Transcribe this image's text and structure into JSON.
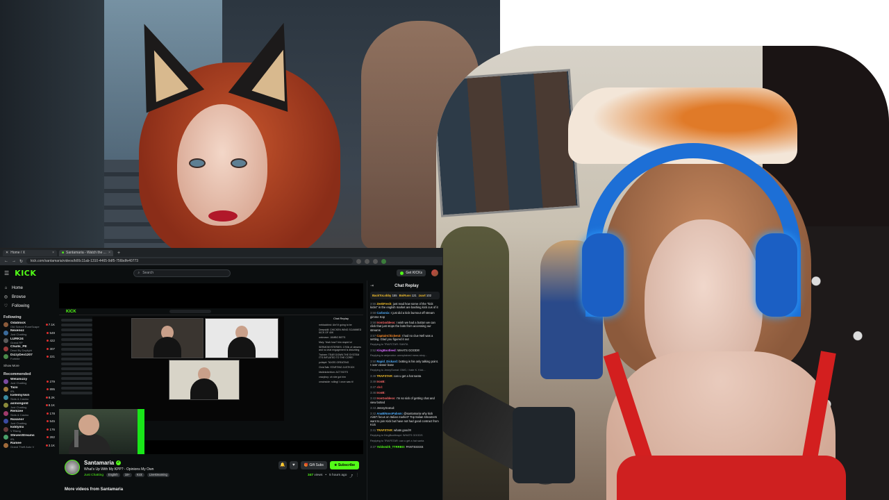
{
  "browser": {
    "tabs": [
      {
        "label": "Home / X",
        "active": false
      },
      {
        "label": "Santamaria - Watch the ...",
        "active": true
      }
    ],
    "url": "kick.com/santamaria/videos/b00c11ab-1310-4465-9df5-756bdfe40773"
  },
  "kick": {
    "logo": "KICK",
    "search_placeholder": "Search",
    "get_kicks_label": "Get KICKs",
    "nav": [
      {
        "icon": "home-icon",
        "glyph": "⌂",
        "label": "Home"
      },
      {
        "icon": "compass-icon",
        "glyph": "◎",
        "label": "Browse"
      },
      {
        "icon": "heart-icon",
        "glyph": "♡",
        "label": "Following"
      }
    ],
    "following_header": "Following",
    "following": [
      {
        "name": "Odablock",
        "sub": "Old School RuneScape",
        "viewers": "7.1K",
        "color": "#8a5a3a"
      },
      {
        "name": "Nexenoz",
        "sub": "Just Chatting",
        "viewers": "549",
        "color": "#3a6a9a"
      },
      {
        "name": "LURK24",
        "sub": "Grand RP",
        "viewers": "422",
        "color": "#5a5a5a"
      },
      {
        "name": "Chulls_PE",
        "sub": "Dead By Daylight",
        "viewers": "307",
        "color": "#9a3a3a"
      },
      {
        "name": "DizzyDev1207",
        "sub": "Fortnite",
        "viewers": "221",
        "color": "#4a8a4a"
      }
    ],
    "show_more": "Show More",
    "recommended_header": "Recommended",
    "recommended": [
      {
        "name": "Welamizzy",
        "sub": "Just Chatting",
        "viewers": "279",
        "color": "#7a4aa0"
      },
      {
        "name": "Tazo",
        "sub": "IRL",
        "viewers": "895",
        "color": "#a07a3a"
      },
      {
        "name": "Icelemyrwin",
        "sub": "Slots & Casino",
        "viewers": "8.2K",
        "color": "#3a8aa0"
      },
      {
        "name": "asmongold",
        "sub": "Just Chatting",
        "viewers": "8.1K",
        "color": "#8a8a3a"
      },
      {
        "name": "Remzee",
        "sub": "Slots & Casino",
        "viewers": "178",
        "color": "#a03a6a"
      },
      {
        "name": "Nuxanor",
        "sub": "Just Chatting",
        "viewers": "545",
        "color": "#3a4aa0"
      },
      {
        "name": "kiddymx",
        "sub": "V Rising",
        "viewers": "176",
        "color": "#6a3a3a"
      },
      {
        "name": "StevenStreams",
        "sub": "IRL",
        "viewers": "282",
        "color": "#4aa06a"
      },
      {
        "name": "Ramee",
        "sub": "Grand Theft Auto V",
        "viewers": "3.1K",
        "color": "#a06a3a"
      }
    ],
    "inner_chat_header": "Chat Replay",
    "inner_chat_lines": [
      "mrblackbird: Ain't it going to be",
      "Deepskill: CHICKEN WING SCAMMED KICK OF 40K",
      "unknown: JUMBO BETS",
      "Mwy: Yeah how? him stupid lol",
      "SERMONYSTERIES: 1700k of viewers and no chat engagement is disturbing",
      "Trainee: TEAR DOWN THE SYSTEM IT'S INFLATED TO THE CORE!",
      "pcbiqet: TAXES GREATING",
      "ChrisTalk: STARTING JUSTKICK",
      "kiwiknickerbon: ACT BOTS",
      "crazyboy: oh she got him",
      "omainside: rolling! I once saw it!"
    ],
    "streamer": {
      "name": "Santamaria",
      "title": "What's Up With My KPP? - Opinions My Own",
      "category": "Just Chatting",
      "tags": [
        "English",
        "18+",
        "Kick",
        "Livestreaming"
      ],
      "gift_label": "Gift Subs",
      "subscribe_label": "Subscribe",
      "views": "347",
      "views_label": "views",
      "age": "5 hours ago",
      "more_videos": "More videos from Santamaria"
    },
    "chat": {
      "title": "Chat Replay",
      "pinned": [
        {
          "name": "BackToLobby",
          "count": "155"
        },
        {
          "name": "BoiRuss",
          "count": "121"
        },
        {
          "name": "zoart",
          "count": "102"
        }
      ],
      "messages": [
        {
          "ts": "3:55",
          "user": "ZeekFresh:",
          "color": "#f6c12d",
          "text": "just read how some of the \"kick kicks\" in the english market are bashing kick cus of it",
          "reply": ""
        },
        {
          "ts": "3:58",
          "user": "Carbonix:",
          "color": "#53b0ff",
          "text": "I just did a kick burnout off stream gimme Kop",
          "reply": ""
        },
        {
          "ts": "3:58",
          "user": "IronGoddess:",
          "color": "#ff6a6a",
          "text": "I wish we had a button we can click that just stops the bots from accessing our streams",
          "reply": ""
        },
        {
          "ts": "3:57",
          "user": "CaptainChicken3:",
          "color": "#ff8c2a",
          "text": "I had no clue Nell was a setting. Glad you figured it out",
          "reply": ""
        },
        {
          "ts": "",
          "user": "",
          "color": "#e2e2e2",
          "text": "",
          "reply": "Replying to TRAFCTAR: SANTA"
        },
        {
          "ts": "3:52",
          "user": "KingBootleed:",
          "color": "#d86aff",
          "text": "WHATS GOOD!!!",
          "reply": ""
        },
        {
          "ts": "",
          "user": "",
          "color": "#e2e2e2",
          "text": "",
          "reply": "Replying to aniproctor: unexplained mess story..."
        },
        {
          "ts": "3:50",
          "user": "Rapid_Dickard:",
          "color": "#53b0ff",
          "text": "botting is his only talking point. I over viewer base",
          "reply": ""
        },
        {
          "ts": "",
          "user": "",
          "color": "#e2e2e2",
          "text": "",
          "reply": "Replying to JennySomal: OMG, i hate K. Kick..."
        },
        {
          "ts": "3:49",
          "user": "TRAFSTAR:",
          "color": "#f6c12d",
          "text": "can u get a hat santa",
          "reply": ""
        },
        {
          "ts": "3:49",
          "user": "IronB:",
          "color": "#ff6a6a",
          "text": "",
          "reply": ""
        },
        {
          "ts": "3:47",
          "user": "shd:",
          "color": "#e05050",
          "text": "",
          "reply": ""
        },
        {
          "ts": "3:46",
          "user": "IronB:",
          "color": "#ff6a6a",
          "text": "",
          "reply": ""
        },
        {
          "ts": "3:43",
          "user": "IronGoddess:",
          "color": "#ff6a6a",
          "text": "I'm so sick of getting chat and view botted",
          "reply": ""
        },
        {
          "ts": "3:43",
          "user": "JennySomal:",
          "color": "#b0b0b0",
          "text": "",
          "reply": ""
        },
        {
          "ts": "3:42",
          "user": "AnaBiNovoPabsm:",
          "color": "#53b0ff",
          "text": "@santamaria why kick Aintr't focus on Italian market? Top Italian streamers want to join Kick but have not had good contract from Kick",
          "reply": ""
        },
        {
          "ts": "3:41",
          "user": "TRAFSTAR:",
          "color": "#f6c12d",
          "text": "whats good!!!",
          "reply": ""
        },
        {
          "ts": "",
          "user": "",
          "color": "#e2e2e2",
          "text": "",
          "reply": "Replying to KingBootfeayd: WHATS GOODS"
        },
        {
          "ts": "",
          "user": "",
          "color": "#e2e2e2",
          "text": "",
          "reply": "Replying to TRAFSTAR: can u get a hat santa"
        },
        {
          "ts": "3:37",
          "user": "Yoldsmith_TTRRBO:",
          "color": "#53fc18",
          "text": "PANTSSSSS",
          "reply": ""
        }
      ]
    }
  }
}
